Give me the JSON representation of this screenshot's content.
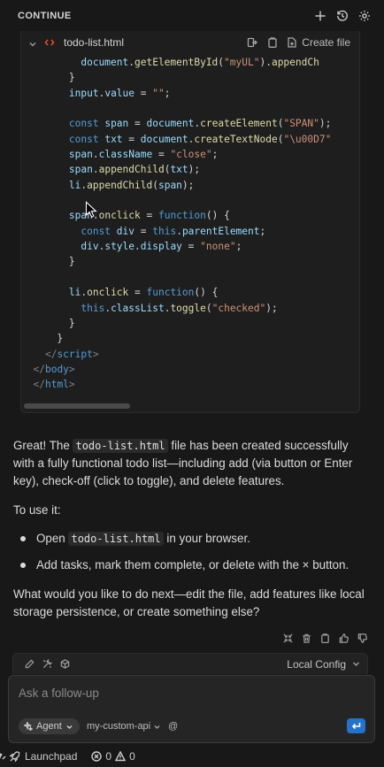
{
  "header": {
    "title": "CONTINUE"
  },
  "codeblock": {
    "filename": "todo-list.html",
    "create_file_label": "Create file",
    "lines": [
      [
        {
          "t": "          ",
          "c": "p"
        },
        {
          "t": "document",
          "c": "v"
        },
        {
          "t": ".",
          "c": "p"
        },
        {
          "t": "getElementById",
          "c": "f"
        },
        {
          "t": "(",
          "c": "p"
        },
        {
          "t": "\"myUL\"",
          "c": "s"
        },
        {
          "t": ").",
          "c": "p"
        },
        {
          "t": "appendCh",
          "c": "f"
        }
      ],
      [
        {
          "t": "        }",
          "c": "p"
        }
      ],
      [
        {
          "t": "        ",
          "c": "p"
        },
        {
          "t": "input",
          "c": "v"
        },
        {
          "t": ".",
          "c": "p"
        },
        {
          "t": "value",
          "c": "v"
        },
        {
          "t": " = ",
          "c": "p"
        },
        {
          "t": "\"\"",
          "c": "s"
        },
        {
          "t": ";",
          "c": "p"
        }
      ],
      [
        {
          "t": "",
          "c": "p"
        }
      ],
      [
        {
          "t": "        ",
          "c": "p"
        },
        {
          "t": "const",
          "c": "k"
        },
        {
          "t": " ",
          "c": "p"
        },
        {
          "t": "span",
          "c": "v"
        },
        {
          "t": " = ",
          "c": "p"
        },
        {
          "t": "document",
          "c": "v"
        },
        {
          "t": ".",
          "c": "p"
        },
        {
          "t": "createElement",
          "c": "f"
        },
        {
          "t": "(",
          "c": "p"
        },
        {
          "t": "\"SPAN\"",
          "c": "s"
        },
        {
          "t": ");",
          "c": "p"
        }
      ],
      [
        {
          "t": "        ",
          "c": "p"
        },
        {
          "t": "const",
          "c": "k"
        },
        {
          "t": " ",
          "c": "p"
        },
        {
          "t": "txt",
          "c": "v"
        },
        {
          "t": " = ",
          "c": "p"
        },
        {
          "t": "document",
          "c": "v"
        },
        {
          "t": ".",
          "c": "p"
        },
        {
          "t": "createTextNode",
          "c": "f"
        },
        {
          "t": "(",
          "c": "p"
        },
        {
          "t": "\"\\u00D7\"",
          "c": "s"
        }
      ],
      [
        {
          "t": "        ",
          "c": "p"
        },
        {
          "t": "span",
          "c": "v"
        },
        {
          "t": ".",
          "c": "p"
        },
        {
          "t": "className",
          "c": "v"
        },
        {
          "t": " = ",
          "c": "p"
        },
        {
          "t": "\"close\"",
          "c": "s"
        },
        {
          "t": ";",
          "c": "p"
        }
      ],
      [
        {
          "t": "        ",
          "c": "p"
        },
        {
          "t": "span",
          "c": "v"
        },
        {
          "t": ".",
          "c": "p"
        },
        {
          "t": "appendChild",
          "c": "f"
        },
        {
          "t": "(",
          "c": "p"
        },
        {
          "t": "txt",
          "c": "v"
        },
        {
          "t": ");",
          "c": "p"
        }
      ],
      [
        {
          "t": "        ",
          "c": "p"
        },
        {
          "t": "li",
          "c": "v"
        },
        {
          "t": ".",
          "c": "p"
        },
        {
          "t": "appendChild",
          "c": "f"
        },
        {
          "t": "(",
          "c": "p"
        },
        {
          "t": "span",
          "c": "v"
        },
        {
          "t": ");",
          "c": "p"
        }
      ],
      [
        {
          "t": "",
          "c": "p"
        }
      ],
      [
        {
          "t": "        ",
          "c": "p"
        },
        {
          "t": "span",
          "c": "v"
        },
        {
          "t": ".",
          "c": "p"
        },
        {
          "t": "onclick",
          "c": "f"
        },
        {
          "t": " = ",
          "c": "p"
        },
        {
          "t": "function",
          "c": "k"
        },
        {
          "t": "() {",
          "c": "p"
        }
      ],
      [
        {
          "t": "          ",
          "c": "p"
        },
        {
          "t": "const",
          "c": "k"
        },
        {
          "t": " ",
          "c": "p"
        },
        {
          "t": "div",
          "c": "v"
        },
        {
          "t": " = ",
          "c": "p"
        },
        {
          "t": "this",
          "c": "k"
        },
        {
          "t": ".",
          "c": "p"
        },
        {
          "t": "parentElement",
          "c": "v"
        },
        {
          "t": ";",
          "c": "p"
        }
      ],
      [
        {
          "t": "          ",
          "c": "p"
        },
        {
          "t": "div",
          "c": "v"
        },
        {
          "t": ".",
          "c": "p"
        },
        {
          "t": "style",
          "c": "v"
        },
        {
          "t": ".",
          "c": "p"
        },
        {
          "t": "display",
          "c": "v"
        },
        {
          "t": " = ",
          "c": "p"
        },
        {
          "t": "\"none\"",
          "c": "s"
        },
        {
          "t": ";",
          "c": "p"
        }
      ],
      [
        {
          "t": "        }",
          "c": "p"
        }
      ],
      [
        {
          "t": "",
          "c": "p"
        }
      ],
      [
        {
          "t": "        ",
          "c": "p"
        },
        {
          "t": "li",
          "c": "v"
        },
        {
          "t": ".",
          "c": "p"
        },
        {
          "t": "onclick",
          "c": "f"
        },
        {
          "t": " = ",
          "c": "p"
        },
        {
          "t": "function",
          "c": "k"
        },
        {
          "t": "() {",
          "c": "p"
        }
      ],
      [
        {
          "t": "          ",
          "c": "p"
        },
        {
          "t": "this",
          "c": "k"
        },
        {
          "t": ".",
          "c": "p"
        },
        {
          "t": "classList",
          "c": "v"
        },
        {
          "t": ".",
          "c": "p"
        },
        {
          "t": "toggle",
          "c": "f"
        },
        {
          "t": "(",
          "c": "p"
        },
        {
          "t": "\"checked\"",
          "c": "s"
        },
        {
          "t": ");",
          "c": "p"
        }
      ],
      [
        {
          "t": "        }",
          "c": "p"
        }
      ],
      [
        {
          "t": "      }",
          "c": "p"
        }
      ],
      [
        {
          "t": "    ",
          "c": "p"
        },
        {
          "t": "</",
          "c": "g"
        },
        {
          "t": "script",
          "c": "k"
        },
        {
          "t": ">",
          "c": "g"
        }
      ],
      [
        {
          "t": "  ",
          "c": "p"
        },
        {
          "t": "</",
          "c": "g"
        },
        {
          "t": "body",
          "c": "k"
        },
        {
          "t": ">",
          "c": "g"
        }
      ],
      [
        {
          "t": "  ",
          "c": "p"
        },
        {
          "t": "</",
          "c": "g"
        },
        {
          "t": "html",
          "c": "k"
        },
        {
          "t": ">",
          "c": "g"
        }
      ]
    ]
  },
  "message": {
    "intro_1": "Great! The ",
    "intro_code": "todo-list.html",
    "intro_2": " file has been created successfully with a fully functional todo list—including add (via button or Enter key), check-off (click to toggle), and delete features.",
    "to_use": "To use it:",
    "bullet_1_a": "Open ",
    "bullet_1_code": "todo-list.html",
    "bullet_1_b": " in your browser.",
    "bullet_2": "Add tasks, mark them complete, or delete with the × button.",
    "closing": "What would you like to do next—edit the file, add features like local storage persistence, or create something else?"
  },
  "toolbar": {
    "config_label": "Local Config"
  },
  "input": {
    "placeholder": "Ask a follow-up",
    "mode_label": "Agent",
    "model_label": "my-custom-api",
    "at_symbol": "@"
  },
  "statusbar": {
    "launchpad_label": "Launchpad",
    "errors_count": "0",
    "warnings_count": "0"
  },
  "colors": {
    "background": "#181818",
    "code_background": "#1e1e1e",
    "send_button": "#2473c9",
    "html_file_icon": "#e44d26"
  }
}
